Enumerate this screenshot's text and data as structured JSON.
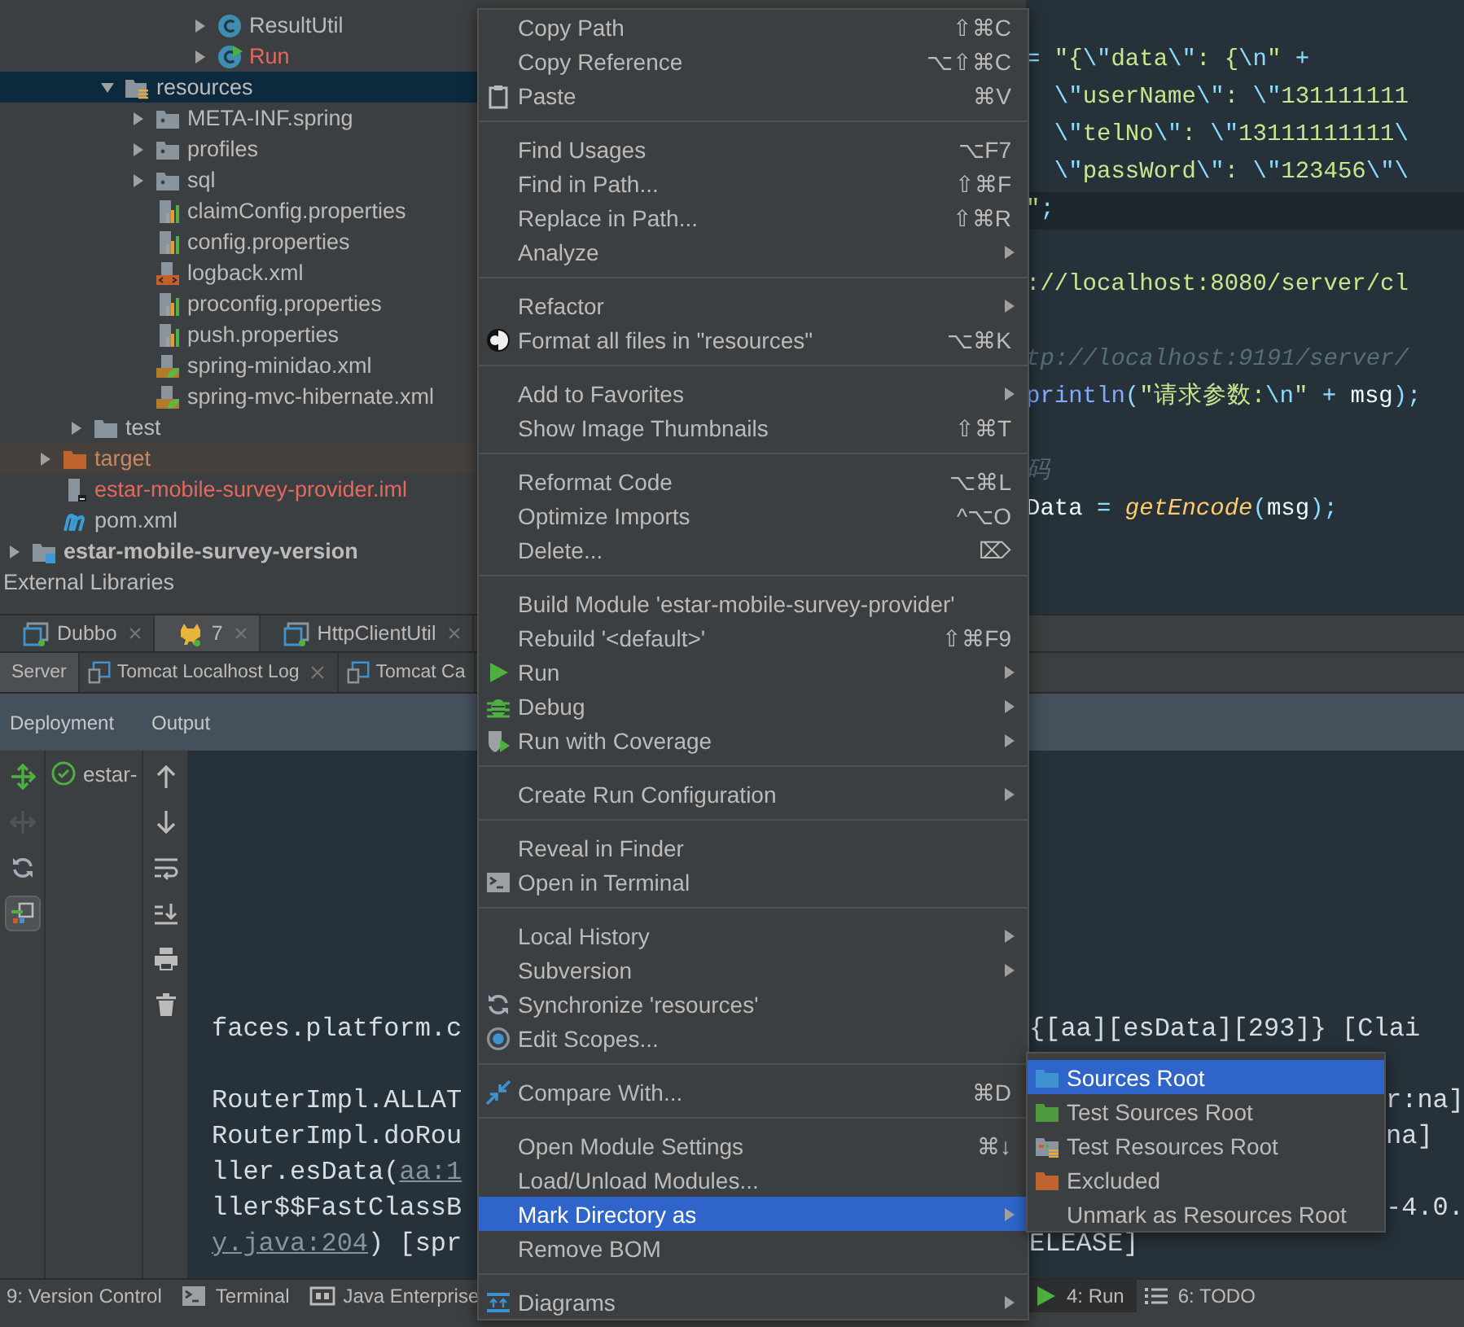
{
  "tree": [
    {
      "children": [
        {
          "children": [
            {
              "children": [
                {
                  "children": [
                    {
                      "children": [
                        {
                          "children": [
                            {
                              "label": "ResultUtil",
                              "kind": "class",
                              "expanded": false,
                              "selected": false
                            },
                            {
                              "label": "Run",
                              "kind": "runnable",
                              "expanded": false,
                              "unversioned": true,
                              "selected": false
                            }
                          ]
                        }
                      ]
                    }
                  ]
                },
                {
                  "label": "resources",
                  "kind": "resources",
                  "expanded": true,
                  "selected": true,
                  "children": [
                    {
                      "label": "META-INF.spring",
                      "kind": "package",
                      "expanded": false,
                      "selected": false
                    },
                    {
                      "label": "profiles",
                      "kind": "package",
                      "expanded": false,
                      "selected": false
                    },
                    {
                      "label": "sql",
                      "kind": "package",
                      "expanded": false,
                      "selected": false
                    },
                    {
                      "label": "claimConfig.properties",
                      "kind": "properties",
                      "selected": false
                    },
                    {
                      "label": "config.properties",
                      "kind": "properties",
                      "selected": false
                    },
                    {
                      "label": "logback.xml",
                      "kind": "xml",
                      "selected": false
                    },
                    {
                      "label": "proconfig.properties",
                      "kind": "properties",
                      "selected": false
                    },
                    {
                      "label": "push.properties",
                      "kind": "properties",
                      "selected": false
                    },
                    {
                      "label": "spring-minidao.xml",
                      "kind": "spring",
                      "selected": false
                    },
                    {
                      "label": "spring-mvc-hibernate.xml",
                      "kind": "spring",
                      "selected": false
                    }
                  ]
                }
              ]
            },
            {
              "label": "test",
              "kind": "folder",
              "expanded": false,
              "selected": false
            }
          ]
        },
        {
          "label": "target",
          "kind": "excluded",
          "expanded": false,
          "selected": false
        },
        {
          "label": "estar-mobile-survey-provider.iml",
          "kind": "iml",
          "unversioned": true,
          "selected": false
        },
        {
          "label": "pom.xml",
          "kind": "maven",
          "selected": false
        }
      ]
    },
    {
      "label": "estar-mobile-survey-version",
      "kind": "module",
      "expanded": false,
      "selected": false
    },
    {
      "label": "External Libraries",
      "selected": false
    }
  ],
  "editor": {
    "lines": [
      {
        "current": false,
        "segments": [
          {
            "kind": "op",
            "text": "= "
          },
          {
            "kind": "str",
            "text": "\"{"
          },
          {
            "kind": "esc",
            "text": "\\\""
          },
          {
            "kind": "str",
            "text": "data"
          },
          {
            "kind": "esc",
            "text": "\\\""
          },
          {
            "kind": "str",
            "text": ": {"
          },
          {
            "kind": "esc",
            "text": "\\n"
          },
          {
            "kind": "str",
            "text": "\""
          },
          {
            "kind": "op",
            "text": " +"
          }
        ]
      },
      {
        "current": false,
        "segments": [
          {
            "kind": "esc",
            "text": "  \\\""
          },
          {
            "kind": "str",
            "text": "userName"
          },
          {
            "kind": "esc",
            "text": "\\\""
          },
          {
            "kind": "str",
            "text": ": "
          },
          {
            "kind": "esc",
            "text": "\\\""
          },
          {
            "kind": "str",
            "text": "131111111"
          }
        ]
      },
      {
        "current": false,
        "segments": [
          {
            "kind": "esc",
            "text": "  \\\""
          },
          {
            "kind": "str",
            "text": "telNo"
          },
          {
            "kind": "esc",
            "text": "\\\""
          },
          {
            "kind": "str",
            "text": ": "
          },
          {
            "kind": "esc",
            "text": "\\\""
          },
          {
            "kind": "str",
            "text": "13111111111"
          },
          {
            "kind": "esc",
            "text": "\\"
          }
        ]
      },
      {
        "current": false,
        "segments": [
          {
            "kind": "esc",
            "text": "  \\\""
          },
          {
            "kind": "str",
            "text": "passWord"
          },
          {
            "kind": "esc",
            "text": "\\\""
          },
          {
            "kind": "str",
            "text": ": "
          },
          {
            "kind": "esc",
            "text": "\\\""
          },
          {
            "kind": "str",
            "text": "123456"
          },
          {
            "kind": "esc",
            "text": "\\\"\\"
          }
        ]
      },
      {
        "current": true,
        "segments": [
          {
            "kind": "str",
            "text": "\""
          },
          {
            "kind": "op",
            "text": ";"
          }
        ]
      },
      {
        "current": false
      },
      {
        "current": false,
        "segments": [
          {
            "kind": "str",
            "text": "://localhost:8080/server/cl"
          }
        ]
      },
      {
        "current": false
      },
      {
        "current": false,
        "segments": [
          {
            "kind": "comment",
            "text": "tp://localhost:9191/server/"
          }
        ]
      },
      {
        "current": false,
        "segments": [
          {
            "kind": "method",
            "text": "println"
          },
          {
            "kind": "op",
            "text": "("
          },
          {
            "kind": "str",
            "text": "\"请求参数:"
          },
          {
            "kind": "esc",
            "text": "\\n"
          },
          {
            "kind": "str",
            "text": "\""
          },
          {
            "kind": "op",
            "text": " + "
          },
          {
            "kind": "plain",
            "text": "msg"
          },
          {
            "kind": "op",
            "text": ");"
          }
        ]
      },
      {
        "current": false
      },
      {
        "current": false,
        "segments": [
          {
            "kind": "comment",
            "text": "码"
          }
        ]
      },
      {
        "current": false,
        "segments": [
          {
            "kind": "plain",
            "text": "Data "
          },
          {
            "kind": "op",
            "text": "= "
          },
          {
            "kind": "func",
            "text": "getEncode"
          },
          {
            "kind": "op",
            "text": "("
          },
          {
            "kind": "plain",
            "text": "msg"
          },
          {
            "kind": "op",
            "text": ");"
          }
        ]
      }
    ]
  },
  "run_tabs": [
    {
      "label": "Dubbo",
      "kind": "console",
      "closable": true,
      "selected": false
    },
    {
      "label": "7",
      "kind": "cat",
      "closable": true,
      "selected": true
    },
    {
      "label": "HttpClientUtil",
      "kind": "console",
      "closable": true,
      "selected": false
    }
  ],
  "server_tabs": [
    {
      "label": "Server",
      "selected": true
    },
    {
      "label": "Tomcat Localhost Log",
      "kind": "log",
      "closable": true,
      "selected": false
    },
    {
      "label": "Tomcat Ca",
      "kind": "log",
      "closable": false,
      "selected": false
    }
  ],
  "columns": [
    "Deployment",
    "Output"
  ],
  "side_tools": [
    {
      "kind": "deploy",
      "disabled": false,
      "selected": false
    },
    {
      "kind": "undeploy",
      "disabled": true,
      "selected": false
    },
    {
      "kind": "refresh",
      "disabled": false,
      "selected": false
    },
    {
      "kind": "view",
      "disabled": false,
      "selected": true
    }
  ],
  "deployments": [
    {
      "label": "estar-"
    }
  ],
  "output_tools": [
    {
      "kind": "up"
    },
    {
      "kind": "down"
    },
    {
      "kind": "wrap"
    },
    {
      "kind": "scroll"
    },
    {
      "kind": "print"
    },
    {
      "kind": "trash"
    }
  ],
  "console": [
    {
      "left": [
        {
          "kind": "text",
          "text": "faces.platform.c"
        }
      ],
      "right": {
        "kind": "beside-menu",
        "text": "{[aa][esData][293]}  [Clai"
      }
    },
    {
      "left": [
        {
          "kind": "text",
          "text": "RouterImpl.ALLAT"
        }
      ],
      "right": {
        "kind": "beside-submenu",
        "text": "r:na]"
      }
    },
    {
      "left": [
        {
          "kind": "text",
          "text": "RouterImpl.doRou"
        }
      ],
      "right": {
        "kind": "beside-submenu",
        "text": "na]"
      }
    },
    {
      "left": [
        {
          "kind": "text",
          "text": "ller.esData("
        },
        {
          "kind": "link",
          "text": "aa:1"
        }
      ]
    },
    {
      "left": [
        {
          "kind": "text",
          "text": "ller$$FastClassB"
        }
      ],
      "right": {
        "kind": "beside-submenu",
        "text": "-4.0."
      }
    },
    {
      "left": [
        {
          "kind": "link",
          "text": "y.java:204"
        },
        {
          "kind": "text",
          "text": ") [spr"
        }
      ],
      "right": {
        "kind": "beside-menu",
        "text": "ELEASE]"
      }
    }
  ],
  "status_bar": {
    "left": [
      {
        "label": "9: Version Control",
        "selected": false
      },
      {
        "label": "Terminal",
        "kind": "terminal",
        "selected": false
      },
      {
        "label": "Java Enterprise",
        "kind": "javaee",
        "selected": false
      }
    ],
    "right": [
      {
        "label": "4: Run",
        "kind": "run",
        "selected": true
      },
      {
        "label": "6: TODO",
        "kind": "todo",
        "selected": false
      }
    ]
  },
  "menu": [
    [
      {
        "label": "Copy Path",
        "shortcut": "⇧⌘C",
        "submenu": false,
        "selected": false
      },
      {
        "label": "Copy Reference",
        "shortcut": "⌥⇧⌘C",
        "submenu": false,
        "selected": false
      },
      {
        "label": "Paste",
        "shortcut": "⌘V",
        "kind": "clipboard",
        "submenu": false,
        "selected": false
      }
    ],
    [
      {
        "label": "Find Usages",
        "shortcut": "⌥F7",
        "submenu": false,
        "selected": false
      },
      {
        "label": "Find in Path...",
        "shortcut": "⇧⌘F",
        "submenu": false,
        "selected": false
      },
      {
        "label": "Replace in Path...",
        "shortcut": "⇧⌘R",
        "submenu": false,
        "selected": false
      },
      {
        "label": "Analyze",
        "submenu": true,
        "selected": false
      }
    ],
    [
      {
        "label": "Refactor",
        "submenu": true,
        "selected": false
      },
      {
        "label": "Format all files in \"resources\"",
        "shortcut": "⌥⌘K",
        "kind": "format",
        "submenu": false,
        "selected": false
      }
    ],
    [
      {
        "label": "Add to Favorites",
        "submenu": true,
        "selected": false
      },
      {
        "label": "Show Image Thumbnails",
        "shortcut": "⇧⌘T",
        "submenu": false,
        "selected": false
      }
    ],
    [
      {
        "label": "Reformat Code",
        "shortcut": "⌥⌘L",
        "submenu": false,
        "selected": false
      },
      {
        "label": "Optimize Imports",
        "shortcut": "^⌥O",
        "submenu": false,
        "selected": false
      },
      {
        "label": "Delete...",
        "shortcut": "⌦",
        "submenu": false,
        "selected": false
      }
    ],
    [
      {
        "label": "Build Module 'estar-mobile-survey-provider'",
        "submenu": false,
        "selected": false
      },
      {
        "label": "Rebuild '<default>'",
        "shortcut": "⇧⌘F9",
        "submenu": false,
        "selected": false
      },
      {
        "label": "Run",
        "kind": "run",
        "submenu": true,
        "selected": false
      },
      {
        "label": "Debug",
        "kind": "debug",
        "submenu": true,
        "selected": false
      },
      {
        "label": "Run with Coverage",
        "kind": "coverage",
        "submenu": true,
        "selected": false
      }
    ],
    [
      {
        "label": "Create Run Configuration",
        "submenu": true,
        "selected": false
      }
    ],
    [
      {
        "label": "Reveal in Finder",
        "submenu": false,
        "selected": false
      },
      {
        "label": "Open in Terminal",
        "kind": "terminal",
        "submenu": false,
        "selected": false
      }
    ],
    [
      {
        "label": "Local History",
        "submenu": true,
        "selected": false
      },
      {
        "label": "Subversion",
        "submenu": true,
        "selected": false
      },
      {
        "label": "Synchronize 'resources'",
        "kind": "refresh",
        "submenu": false,
        "selected": false
      },
      {
        "label": "Edit Scopes...",
        "kind": "scope",
        "submenu": false,
        "selected": false
      }
    ],
    [
      {
        "label": "Compare With...",
        "shortcut": "⌘D",
        "kind": "compare",
        "submenu": false,
        "selected": false
      }
    ],
    [
      {
        "label": "Open Module Settings",
        "shortcut": "⌘↓",
        "submenu": false,
        "selected": false
      },
      {
        "label": "Load/Unload Modules...",
        "submenu": false,
        "selected": false
      },
      {
        "label": "Mark Directory as",
        "submenu": true,
        "selected": true
      },
      {
        "label": "Remove BOM",
        "submenu": false,
        "selected": false
      }
    ],
    [
      {
        "label": "Diagrams",
        "kind": "diagram",
        "submenu": true,
        "selected": false
      }
    ]
  ],
  "submenu": [
    {
      "label": "Sources Root",
      "kind": "sources",
      "selected": true
    },
    {
      "label": "Test Sources Root",
      "kind": "tests",
      "selected": false
    },
    {
      "label": "Test Resources Root",
      "kind": "testresources",
      "selected": false
    },
    {
      "label": "Excluded",
      "kind": "excluded",
      "selected": false
    },
    {
      "label": "Unmark as Resources Root",
      "selected": false
    }
  ]
}
